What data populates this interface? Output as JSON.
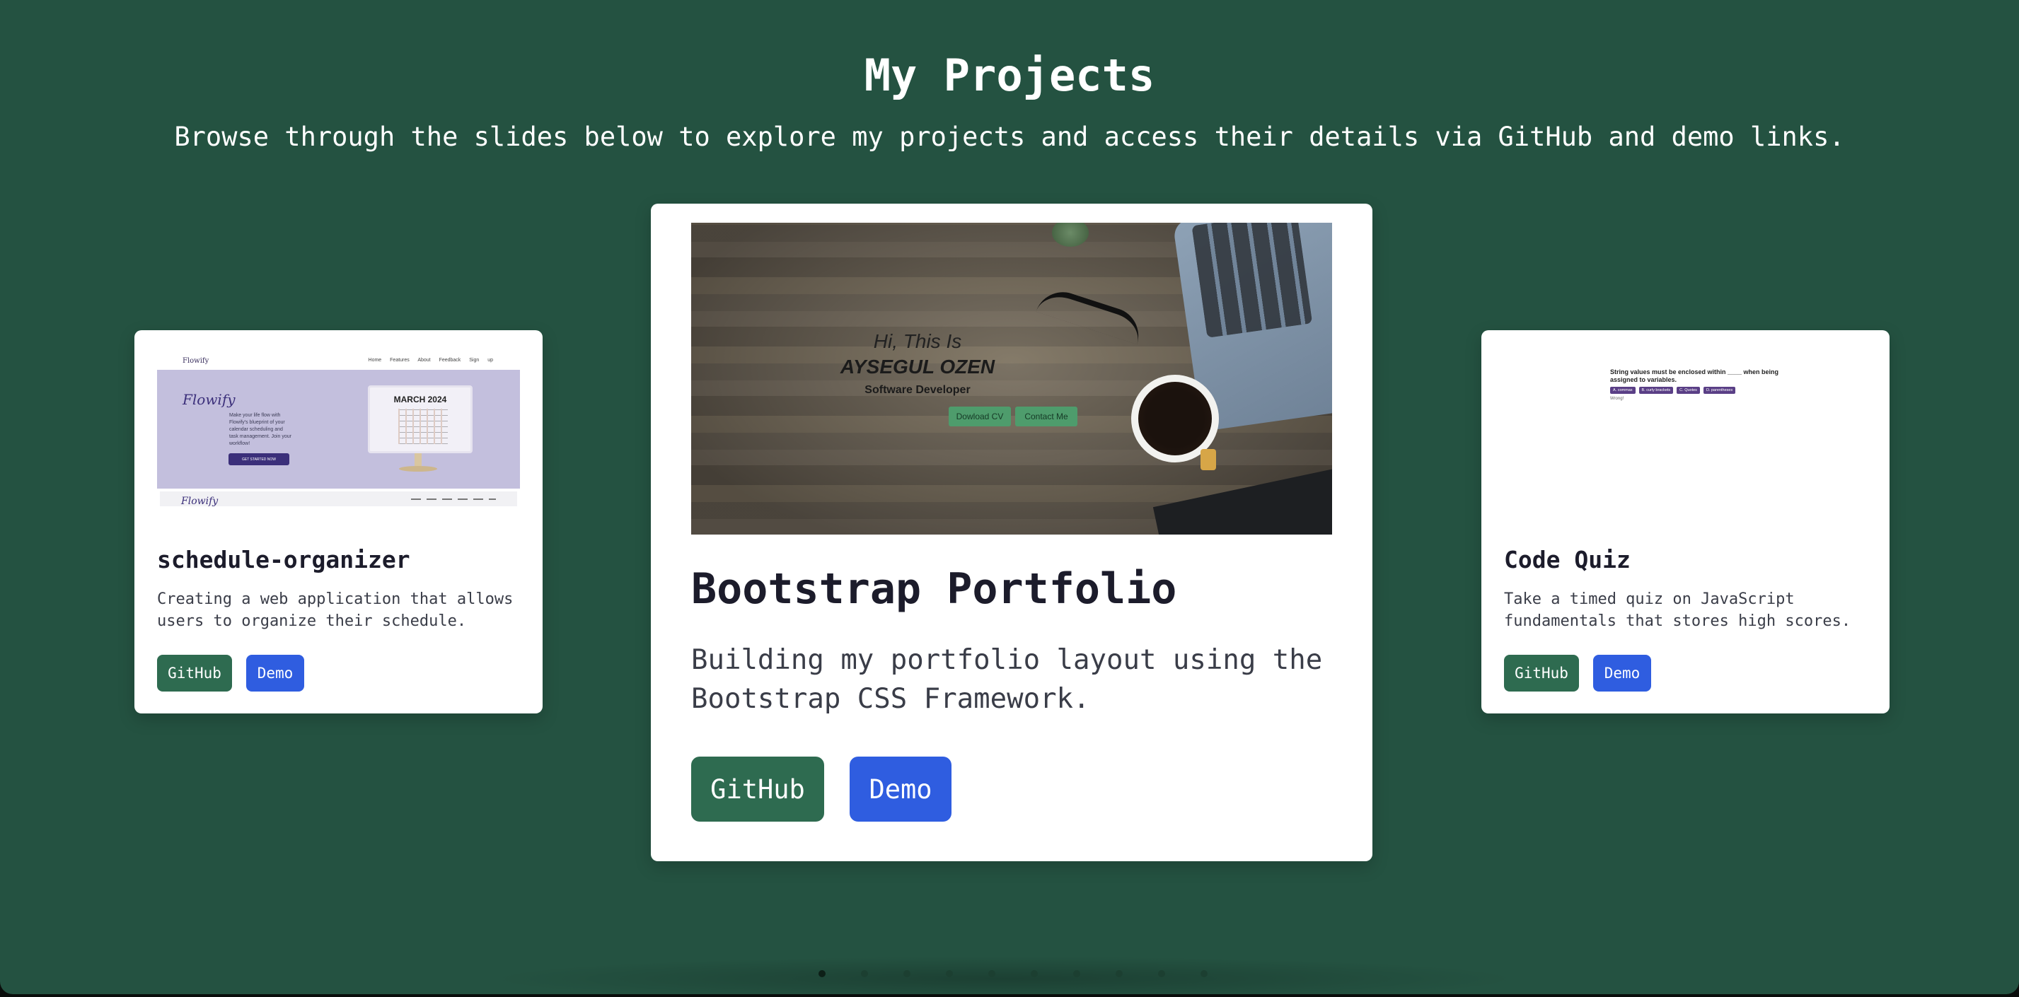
{
  "header": {
    "title": "My Projects",
    "subtitle": "Browse through the slides below to explore my projects and access their details via GitHub and demo links."
  },
  "colors": {
    "background": "#245241",
    "github_button": "#2e6b50",
    "demo_button": "#2f5de0"
  },
  "projects": [
    {
      "title": "schedule-organizer",
      "description": "Creating a web application that allows users to organize their schedule.",
      "github_label": "GitHub",
      "demo_label": "Demo",
      "thumb": {
        "logo": "Flowify",
        "nav_links": "Home Features About Feedback Sign up",
        "brand": "Flowify",
        "copy": "Make your life flow with Flowify's blueprint of your calendar scheduling and task management. Join your workflow!",
        "cta": "GET STARTED NOW",
        "calendar_title": "MARCH 2024",
        "strip_logo": "Flowify"
      }
    },
    {
      "title": "Bootstrap Portfolio",
      "description": "Building my portfolio layout using the Bootstrap CSS Framework.",
      "github_label": "GitHub",
      "demo_label": "Demo",
      "thumb": {
        "greeting": "Hi, This Is",
        "name": "AYSEGUL OZEN",
        "role": "Software Developer",
        "button_1": "Dowload CV",
        "button_2": "Contact Me"
      }
    },
    {
      "title": "Code Quiz",
      "description": "Take a timed quiz on JavaScript fundamentals that stores high scores.",
      "github_label": "GitHub",
      "demo_label": "Demo",
      "thumb": {
        "question": "String values must be enclosed within ____ when being assigned to variables.",
        "options": [
          "A. commas",
          "B. curly brackets",
          "C. Quotes",
          "D. parentheses"
        ],
        "result": "Wrong!"
      }
    }
  ],
  "carousel": {
    "slide_count": 10,
    "active_index": 0
  }
}
